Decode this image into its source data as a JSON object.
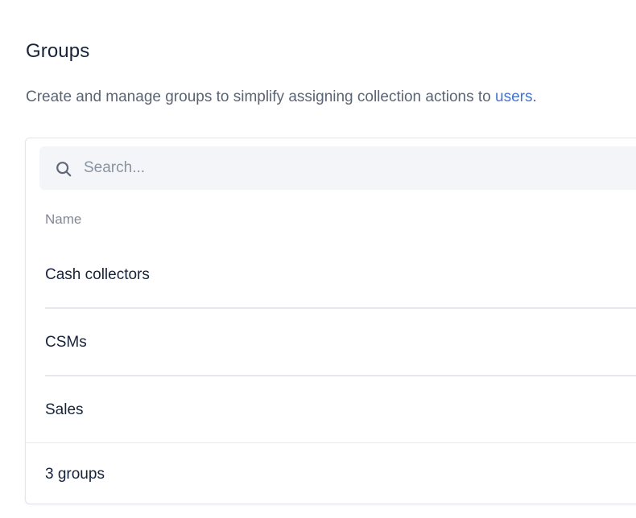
{
  "page": {
    "title": "Groups",
    "description_prefix": "Create and manage groups to simplify assigning collection actions to ",
    "description_link": "users",
    "description_suffix": "."
  },
  "search": {
    "icon": "search-icon",
    "placeholder": "Search..."
  },
  "table": {
    "columns": [
      "Name"
    ],
    "rows": [
      {
        "name": "Cash collectors"
      },
      {
        "name": "CSMs"
      },
      {
        "name": "Sales"
      }
    ],
    "footer_count": "3 groups"
  },
  "colors": {
    "link": "#3f73d6",
    "title": "#16233a",
    "muted": "#5b6473",
    "search_bg": "#f3f5f8"
  }
}
